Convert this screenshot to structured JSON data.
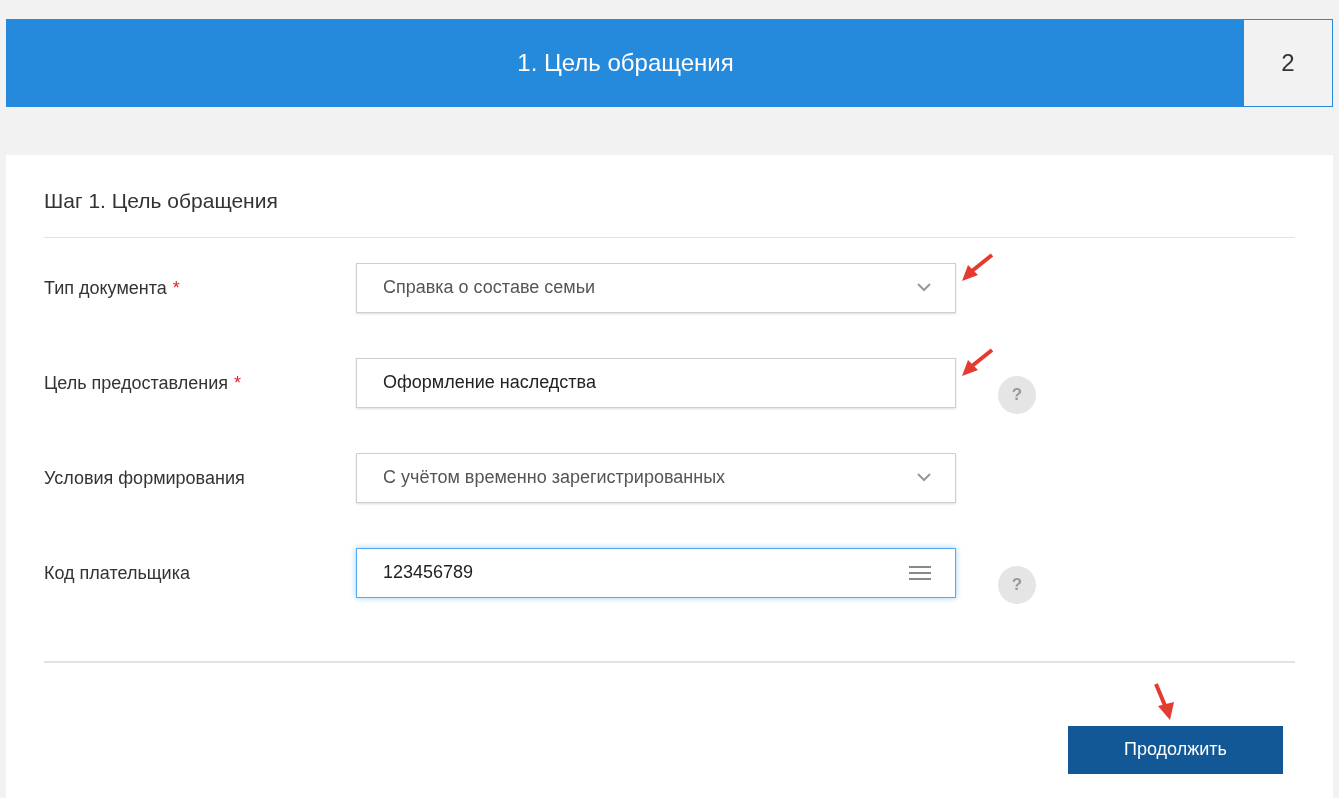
{
  "steps": [
    {
      "label": "1. Цель обращения",
      "selected": true
    },
    {
      "label": "2",
      "selected": false
    }
  ],
  "form": {
    "title": "Шаг 1. Цель обращения",
    "fields": [
      {
        "kind": "select",
        "label": "Тип документа",
        "required_mark": "*",
        "value": "Справка о составе семьи",
        "focused": false,
        "marked": true
      },
      {
        "kind": "text",
        "label": "Цель предоставления",
        "required_mark": "*",
        "value": "Оформление наследства",
        "help": "?",
        "focused": false,
        "marked": true
      },
      {
        "kind": "select",
        "label": "Условия формирования",
        "value": "С учётом временно зарегистрированных",
        "focused": false,
        "marked": false
      },
      {
        "kind": "menu",
        "label": "Код плательщика",
        "value": "123456789",
        "help": "?",
        "focused": true,
        "marked": false
      }
    ],
    "button": {
      "label": "Продолжить",
      "marked": true
    }
  }
}
